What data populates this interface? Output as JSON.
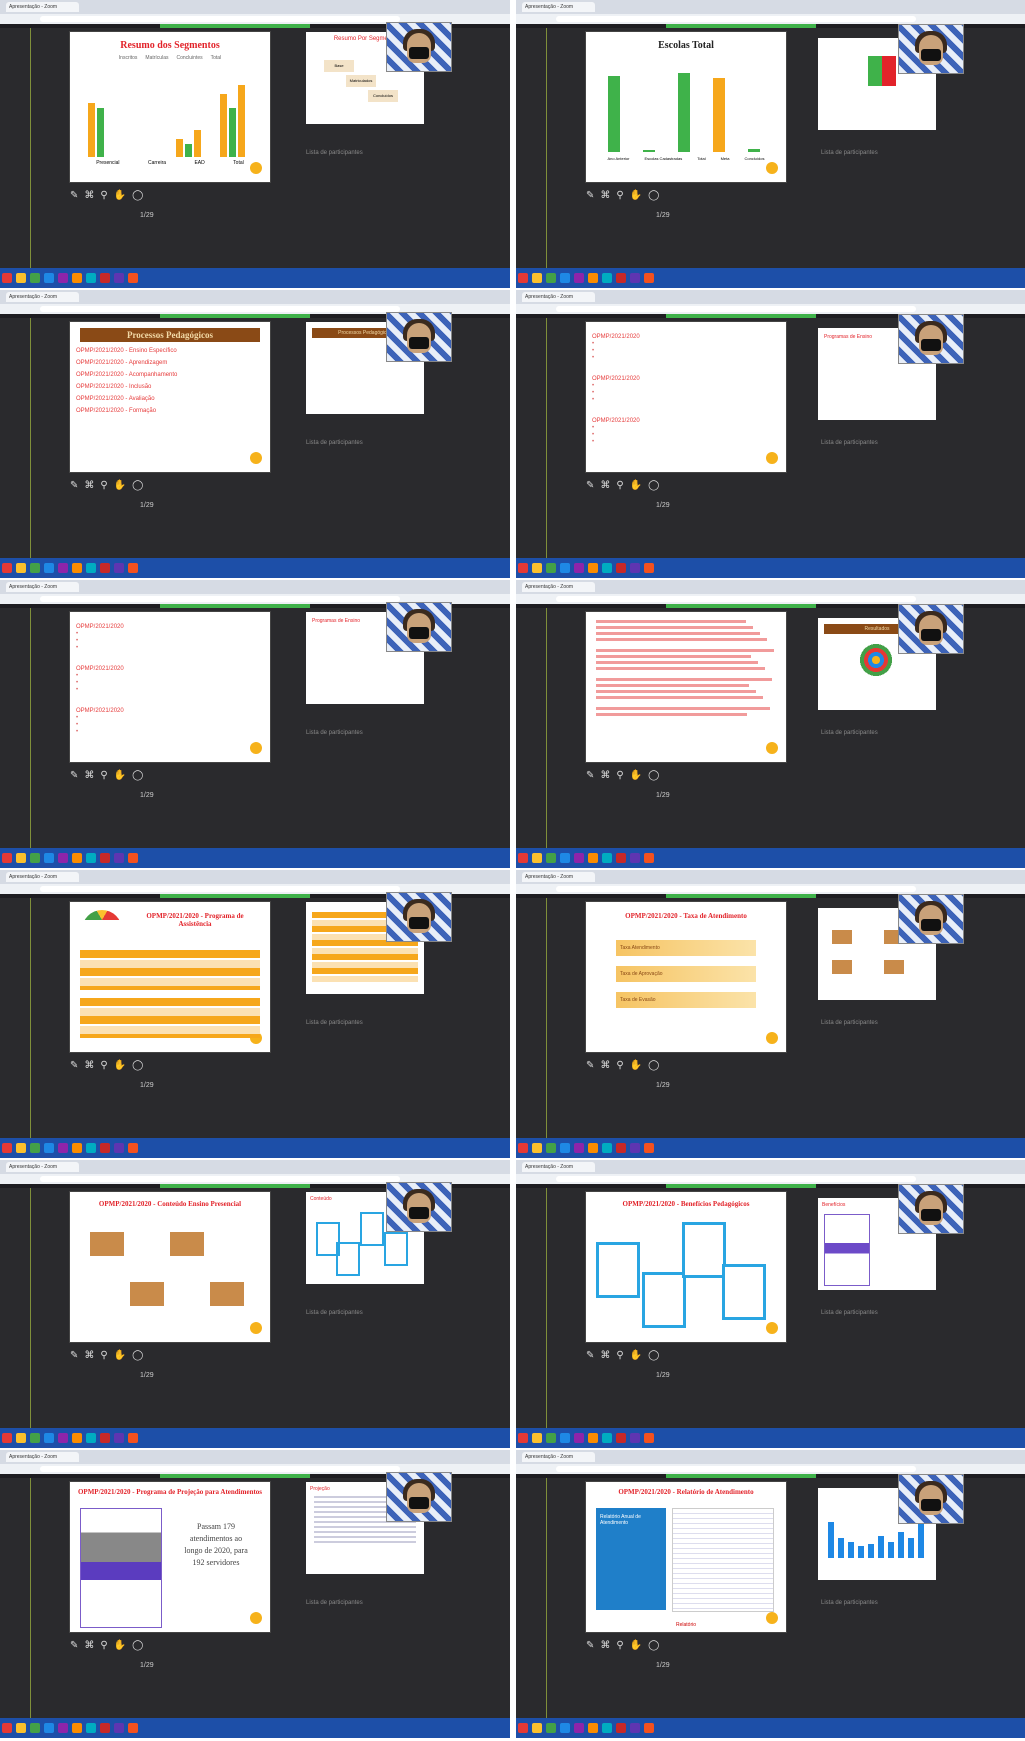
{
  "window": {
    "tab_label": "Apresentação - Zoom",
    "sidebar_label": "Lista de participantes"
  },
  "shots": [
    {
      "id": "resumo",
      "slide_title": "Resumo dos Segmentos",
      "legend": [
        "Inscritos",
        "Matrículas",
        "Concluintes",
        "Total"
      ],
      "categories": [
        "Presencial",
        "Carreira",
        "EAD",
        "Total"
      ],
      "mini_title": "Resumo Por Segmento",
      "mini_labels": [
        "Base",
        "Matriculados",
        "Concluídos"
      ]
    },
    {
      "id": "escolas",
      "slide_title": "Escolas Total",
      "categories": [
        "Ano Anterior",
        "Escolas Cadastradas",
        "Total",
        "Meta",
        "Concluídos"
      ]
    },
    {
      "id": "processos",
      "slide_title": "Processos Pedagógicos",
      "items": [
        "OPMP/2021/2020 - Ensino Específico",
        "OPMP/2021/2020 - Aprendizagem",
        "OPMP/2021/2020 - Acompanhamento",
        "OPMP/2021/2020 - Inclusão",
        "OPMP/2021/2020 - Avaliação",
        "OPMP/2021/2020 - Formação"
      ],
      "mini_title": "Processos Pedagógicos"
    },
    {
      "id": "lista1",
      "items": [
        "OPMP/2021/2020",
        "OPMP/2021/2020",
        "OPMP/2021/2020"
      ],
      "mini_title": "Programas de Ensino"
    },
    {
      "id": "lista2",
      "items": [
        "OPMP/2021/2020",
        "OPMP/2021/2020",
        "OPMP/2021/2020"
      ],
      "mini_title": "Programas de Ensino"
    },
    {
      "id": "texto",
      "mini_title": "Resultados"
    },
    {
      "id": "programa",
      "slide_title": "OPMP/2021/2020 - Programa de Assistência",
      "mini_title": "Tabela"
    },
    {
      "id": "atend",
      "slide_title": "OPMP/2021/2020 - Taxa de Atendimento",
      "boxes": [
        "Taxa Atendimento",
        "Taxa de Aprovação",
        "Taxa de Evasão"
      ]
    },
    {
      "id": "ensino",
      "slide_title": "OPMP/2021/2020 - Conteúdo Ensino Presencial",
      "mini_title": "Conteúdo"
    },
    {
      "id": "reunioes",
      "slide_title": "OPMP/2021/2020 - Benefícios Pedagógicos",
      "mini_title": "Benefícios"
    },
    {
      "id": "projecao",
      "slide_title": "OPMP/2021/2020 - Programa de Projeção para Atendimentos",
      "body": [
        "Passam 179",
        "atendimentos ao",
        "longo de 2020, para",
        "192 servidores"
      ],
      "mini_title": "Projeção"
    },
    {
      "id": "relatorio",
      "slide_title": "OPMP/2021/2020 - Relatório de Atendimento",
      "cover_title": "Relatório Anual de Atendimento",
      "footer": "Relatório"
    }
  ],
  "ui": {
    "toolbar_icons": [
      "pencil-icon",
      "stamp-icon",
      "zoom-icon",
      "hand-icon",
      "comment-icon"
    ],
    "page_ctrl": "1/29"
  },
  "colors": {
    "green": "#3fb24a",
    "orange": "#f6a71b",
    "red": "#e2232a",
    "brown": "#8a4a16",
    "taskbar": "#1d4fa8"
  }
}
